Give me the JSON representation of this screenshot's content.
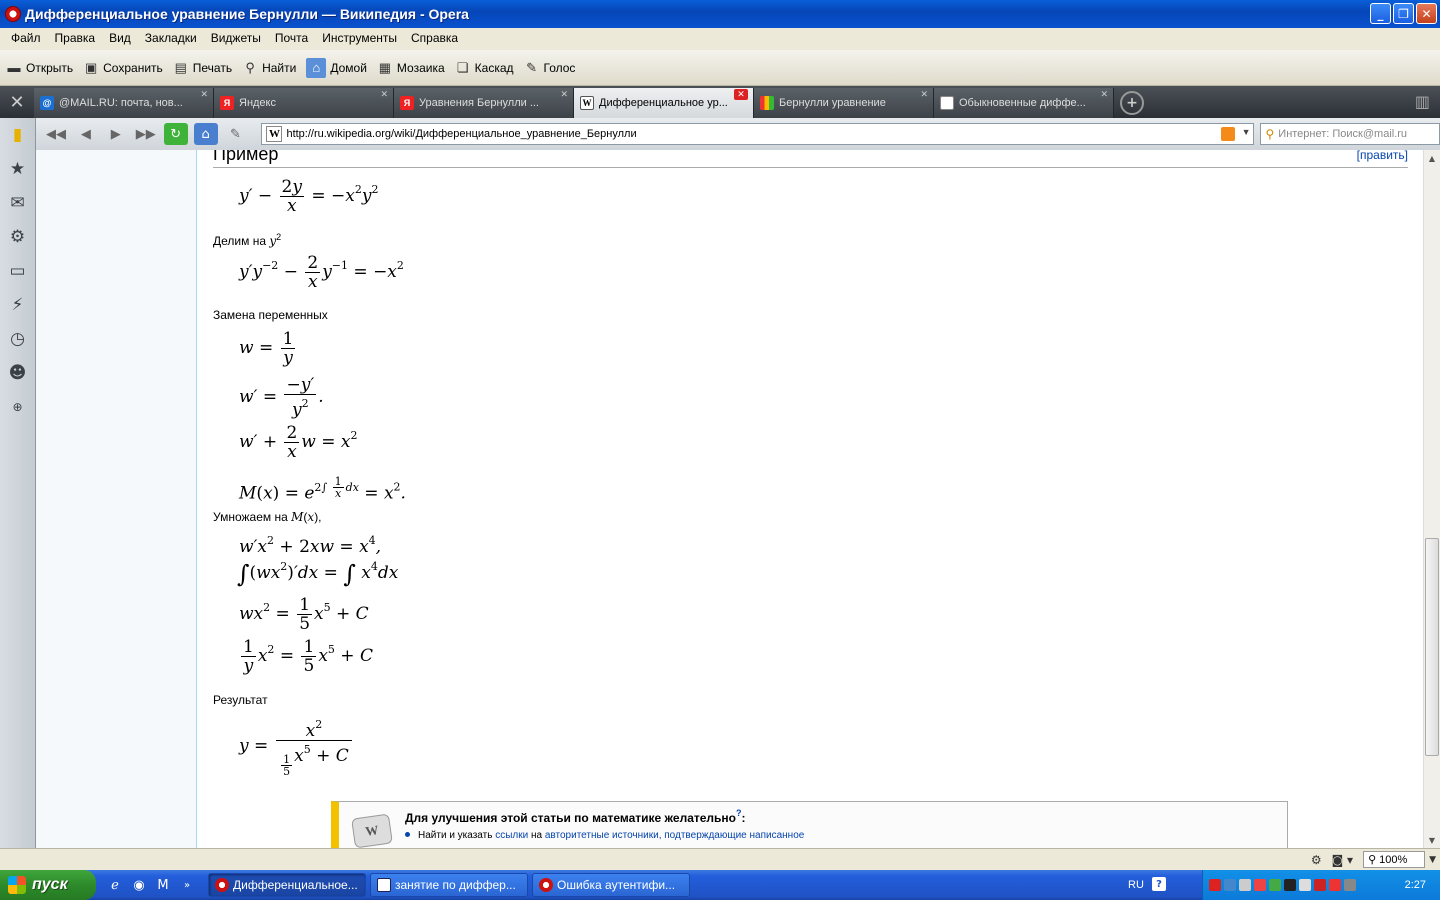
{
  "window": {
    "title": "Дифференциальное уравнение Бернулли — Википедия - Opera",
    "minimize_icon": "minimize-icon",
    "maximize_icon": "maximize-icon",
    "close_icon": "close-icon"
  },
  "menu": [
    "Файл",
    "Правка",
    "Вид",
    "Закладки",
    "Виджеты",
    "Почта",
    "Инструменты",
    "Справка"
  ],
  "toolbar": {
    "open": "Открыть",
    "save": "Сохранить",
    "print": "Печать",
    "find": "Найти",
    "home": "Домой",
    "mosaic": "Мозаика",
    "cascade": "Каскад",
    "voice": "Голос"
  },
  "tabs": [
    {
      "label": "@MAIL.RU: почта, нов...",
      "active": false
    },
    {
      "label": "Яндекс",
      "active": false
    },
    {
      "label": "Уравнения Бернулли ...",
      "active": false
    },
    {
      "label": "Дифференциальное ур...",
      "active": true
    },
    {
      "label": "Бернулли уравнение",
      "active": false
    },
    {
      "label": "Обыкновенные диффе...",
      "active": false
    }
  ],
  "address": {
    "url": "http://ru.wikipedia.org/wiki/Дифференциальное_уравнение_Бернулли",
    "search_placeholder": "Интернет: Поиск@mail.ru"
  },
  "article": {
    "section_title": "Пример",
    "edit_link": "[править]",
    "divide_text": "Делим на",
    "substitution_text": "Замена переменных",
    "multiply_text": "Умножаем на",
    "result_text": "Результат"
  },
  "notice": {
    "title": "Для улучшения этой статьи по математике желательно",
    "qmark": "?",
    "colon": ":",
    "line_prefix": "Найти и указать",
    "link1": "ссылки",
    "middle": "на",
    "link2": "авторитетные источники, подтверждающие написанное"
  },
  "statusbar": {
    "zoom": "100%"
  },
  "taskbar": {
    "start": "пуск",
    "tasks": [
      {
        "label": "Дифференциальное...",
        "active": true
      },
      {
        "label": "занятие по диффер...",
        "active": false
      },
      {
        "label": "Ошибка аутентифи...",
        "active": false
      }
    ],
    "lang": "RU",
    "clock": "2:27"
  }
}
